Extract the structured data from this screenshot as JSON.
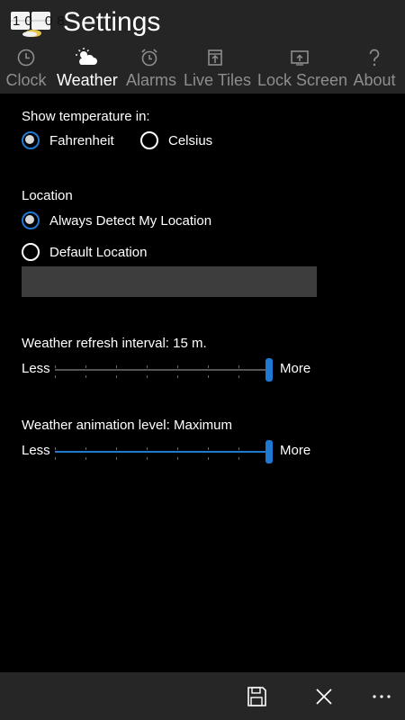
{
  "header": {
    "app_icon_time": "10 08",
    "title": "Settings",
    "tabs": [
      {
        "label": "Clock",
        "icon": "clock-icon",
        "active": false
      },
      {
        "label": "Weather",
        "icon": "weather-icon",
        "active": true
      },
      {
        "label": "Alarms",
        "icon": "alarm-icon",
        "active": false
      },
      {
        "label": "Live Tiles",
        "icon": "live-tiles-icon",
        "active": false
      },
      {
        "label": "Lock Screen",
        "icon": "lock-screen-icon",
        "active": false
      },
      {
        "label": "About",
        "icon": "question-icon",
        "active": false
      }
    ]
  },
  "temperature": {
    "label": "Show temperature in:",
    "options": [
      {
        "label": "Fahrenheit",
        "checked": true
      },
      {
        "label": "Celsius",
        "checked": false
      }
    ]
  },
  "location": {
    "label": "Location",
    "options": [
      {
        "label": "Always Detect My Location",
        "checked": true
      },
      {
        "label": "Default Location",
        "checked": false
      }
    ],
    "input_value": ""
  },
  "refresh": {
    "label": "Weather refresh interval:",
    "value": "15 m.",
    "less": "Less",
    "more": "More",
    "level": 1.0,
    "filled": false
  },
  "animation": {
    "label": "Weather animation level:",
    "value": "Maximum",
    "less": "Less",
    "more": "More",
    "level": 1.0,
    "filled": true
  },
  "appbar": {
    "buttons": [
      {
        "icon": "save-icon"
      },
      {
        "icon": "close-icon"
      },
      {
        "icon": "more-icon"
      }
    ]
  },
  "colors": {
    "accent": "#1f78d1",
    "header_bg": "#252525",
    "appbar_bg": "#262626",
    "inactive_tab": "#8e8e8e"
  }
}
